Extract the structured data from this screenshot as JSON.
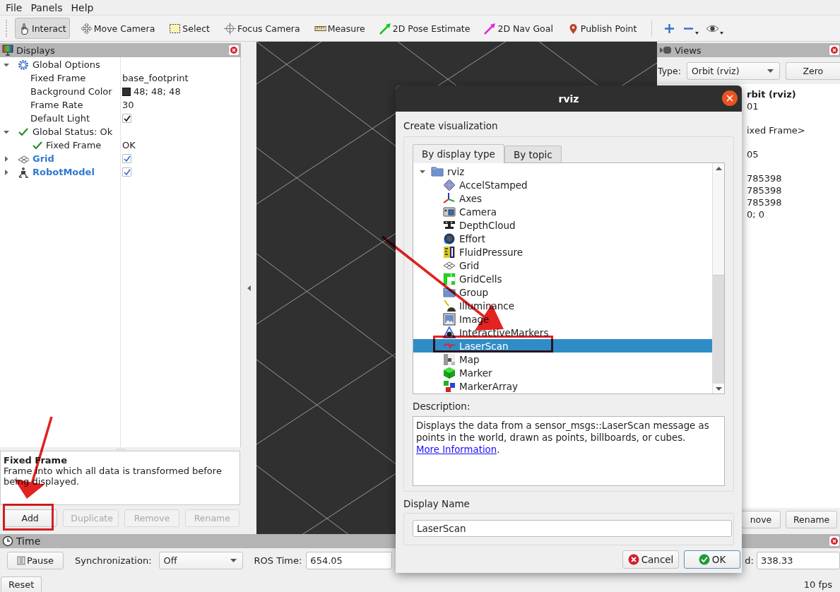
{
  "menu": [
    "File",
    "Panels",
    "Help"
  ],
  "toolbar": [
    {
      "label": "Interact",
      "selected": true
    },
    {
      "label": "Move Camera",
      "selected": false
    },
    {
      "label": "Select",
      "selected": false
    },
    {
      "label": "Focus Camera",
      "selected": false
    },
    {
      "label": "Measure",
      "selected": false
    },
    {
      "label": "2D Pose Estimate",
      "selected": false
    },
    {
      "label": "2D Nav Goal",
      "selected": false
    },
    {
      "label": "Publish Point",
      "selected": false
    }
  ],
  "displays_panel": {
    "title": "Displays",
    "tree": [
      {
        "label": "Global Options",
        "kind": "group",
        "expanded": true,
        "children": [
          {
            "label": "Fixed Frame",
            "kind": "text",
            "value": "base_footprint"
          },
          {
            "label": "Background Color",
            "kind": "color",
            "value": "48; 48; 48",
            "color": "#303030"
          },
          {
            "label": "Frame Rate",
            "kind": "text",
            "value": "30"
          },
          {
            "label": "Default Light",
            "kind": "check",
            "checked": true
          }
        ]
      },
      {
        "label": "Global Status: Ok",
        "kind": "group",
        "expanded": true,
        "children": [
          {
            "label": "Fixed Frame",
            "kind": "status",
            "value": "OK"
          }
        ]
      },
      {
        "label": "Grid",
        "kind": "display",
        "expanded": false,
        "checked": true
      },
      {
        "label": "RobotModel",
        "kind": "display",
        "expanded": false,
        "checked": true
      }
    ],
    "help_title": "Fixed Frame",
    "help_text": "Frame into which all data is transformed before being displayed.",
    "buttons": [
      {
        "label": "Add",
        "disabled": false
      },
      {
        "label": "Duplicate",
        "disabled": true
      },
      {
        "label": "Remove",
        "disabled": true
      },
      {
        "label": "Rename",
        "disabled": true
      }
    ]
  },
  "views_panel": {
    "title": "Views",
    "type_label": "Type:",
    "type_value": "Orbit (rviz)",
    "zero": "Zero",
    "groups": [
      [
        {
          "text": "rbit (rviz)",
          "bold": true
        },
        {
          "text": "01",
          "bold": false
        }
      ],
      [
        {
          "text": "ixed Frame>",
          "bold": false
        }
      ],
      [
        {
          "text": "05",
          "bold": false
        }
      ],
      [
        {
          "text": "785398",
          "bold": false
        },
        {
          "text": "785398",
          "bold": false
        },
        {
          "text": "785398",
          "bold": false
        },
        {
          "text": "0; 0",
          "bold": false
        }
      ]
    ],
    "buttons": [
      "nove",
      "Rename"
    ]
  },
  "time_panel": {
    "title": "Time",
    "pause": "Pause",
    "sync_label": "Synchronization:",
    "sync_value": "Off",
    "ros_time_label": "ROS Time:",
    "ros_time": "654.05",
    "elapsed_label": "d:",
    "elapsed": "338.33",
    "reset": "Reset",
    "fps": "10 fps"
  },
  "dialog": {
    "title": "rviz",
    "heading": "Create visualization",
    "tabs": [
      {
        "label": "By display type",
        "selected": true
      },
      {
        "label": "By topic",
        "selected": false
      }
    ],
    "tree": [
      {
        "label": "rviz",
        "expanded": true,
        "children": [
          {
            "label": "AccelStamped",
            "selected": false
          },
          {
            "label": "Axes",
            "selected": false
          },
          {
            "label": "Camera",
            "selected": false
          },
          {
            "label": "DepthCloud",
            "selected": false
          },
          {
            "label": "Effort",
            "selected": false
          },
          {
            "label": "FluidPressure",
            "selected": false
          },
          {
            "label": "Grid",
            "selected": false
          },
          {
            "label": "GridCells",
            "selected": false
          },
          {
            "label": "Group",
            "selected": false
          },
          {
            "label": "Illuminance",
            "selected": false
          },
          {
            "label": "Image",
            "selected": false
          },
          {
            "label": "InteractiveMarkers",
            "selected": false
          },
          {
            "label": "LaserScan",
            "selected": true
          },
          {
            "label": "Map",
            "selected": false
          },
          {
            "label": "Marker",
            "selected": false
          },
          {
            "label": "MarkerArray",
            "selected": false
          }
        ]
      }
    ],
    "description_label": "Description:",
    "description": "Displays the data from a sensor_msgs::LaserScan message as points in the world, drawn as points, billboards, or cubes.",
    "link": "More Information",
    "description_suffix": ".",
    "name_label": "Display Name",
    "name_value": "LaserScan",
    "buttons": [
      {
        "label": "Cancel",
        "kind": "cancel",
        "default": false
      },
      {
        "label": "OK",
        "kind": "ok",
        "default": true
      }
    ]
  }
}
